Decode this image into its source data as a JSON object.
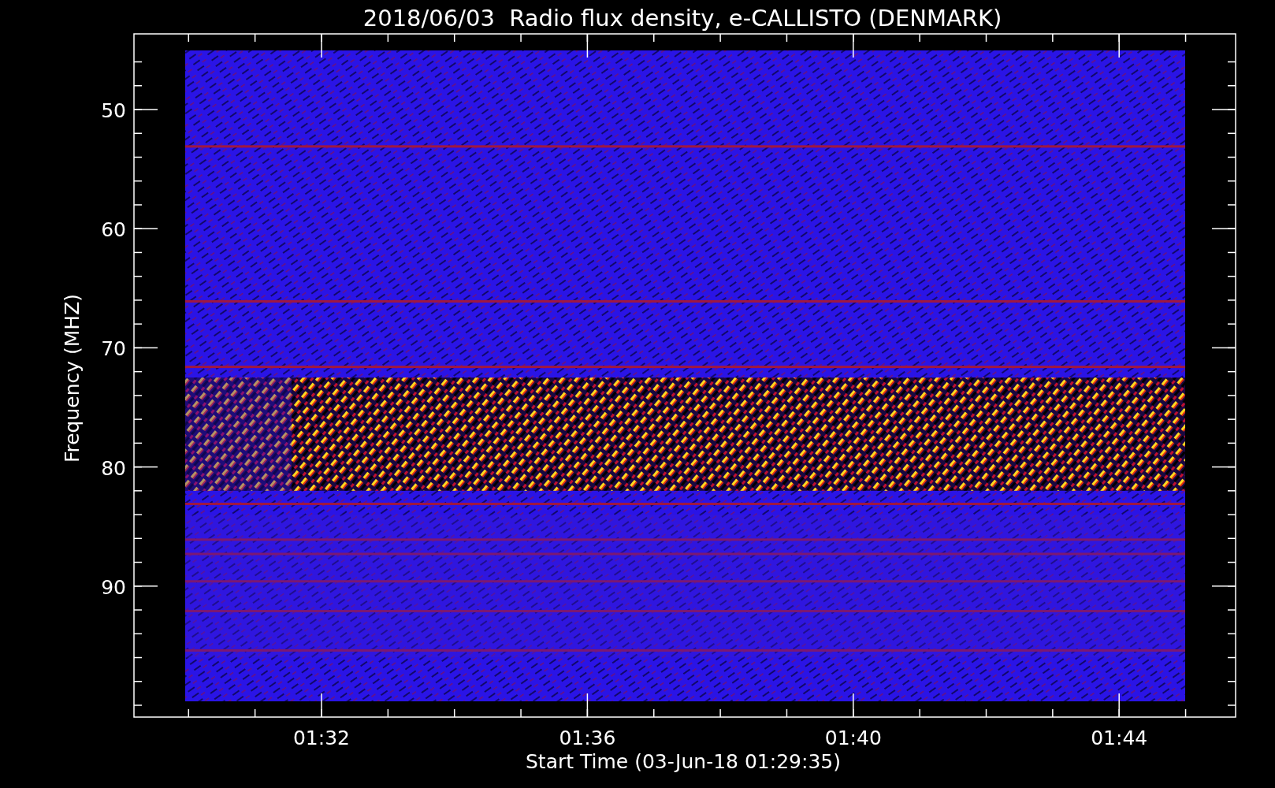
{
  "title": "2018/06/03  Radio flux density, e-CALLISTO (DENMARK)",
  "y_axis": {
    "label": "Frequency (MHZ)",
    "ticks": [
      "50",
      "60",
      "70",
      "80",
      "90"
    ]
  },
  "x_axis": {
    "label": "Start Time (03-Jun-18 01:29:35)",
    "ticks": [
      "01:32",
      "01:36",
      "01:40",
      "01:44"
    ]
  }
}
